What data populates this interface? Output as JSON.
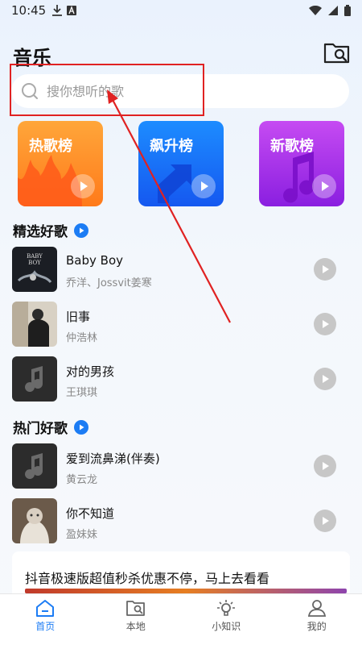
{
  "status": {
    "time": "10:45"
  },
  "page": {
    "title": "音乐"
  },
  "search": {
    "placeholder": "搜你想听的歌"
  },
  "charts": [
    {
      "label": "热歌榜",
      "color": "#ff8f26"
    },
    {
      "label": "飙升榜",
      "color": "#1a74fa"
    },
    {
      "label": "新歌榜",
      "color": "#b03ff0"
    }
  ],
  "sections": {
    "picks": "精选好歌",
    "hot": "热门好歌"
  },
  "picks": [
    {
      "title": "Baby Boy",
      "artist": "乔洋、Jossvit姜寒"
    },
    {
      "title": "旧事",
      "artist": "仲浩林"
    },
    {
      "title": "对的男孩",
      "artist": "王琪琪"
    }
  ],
  "hot": [
    {
      "title": "爱到流鼻涕(伴奏)",
      "artist": "黄云龙"
    },
    {
      "title": "你不知道",
      "artist": "盈妹妹"
    }
  ],
  "promo": {
    "text": "抖音极速版超值秒杀优惠不停，马上去看看"
  },
  "tabs": [
    {
      "label": "首页",
      "active": true
    },
    {
      "label": "本地",
      "active": false
    },
    {
      "label": "小知识",
      "active": false
    },
    {
      "label": "我的",
      "active": false
    }
  ],
  "colors": {
    "accent": "#1c7cf4",
    "annotation": "#e02222"
  }
}
